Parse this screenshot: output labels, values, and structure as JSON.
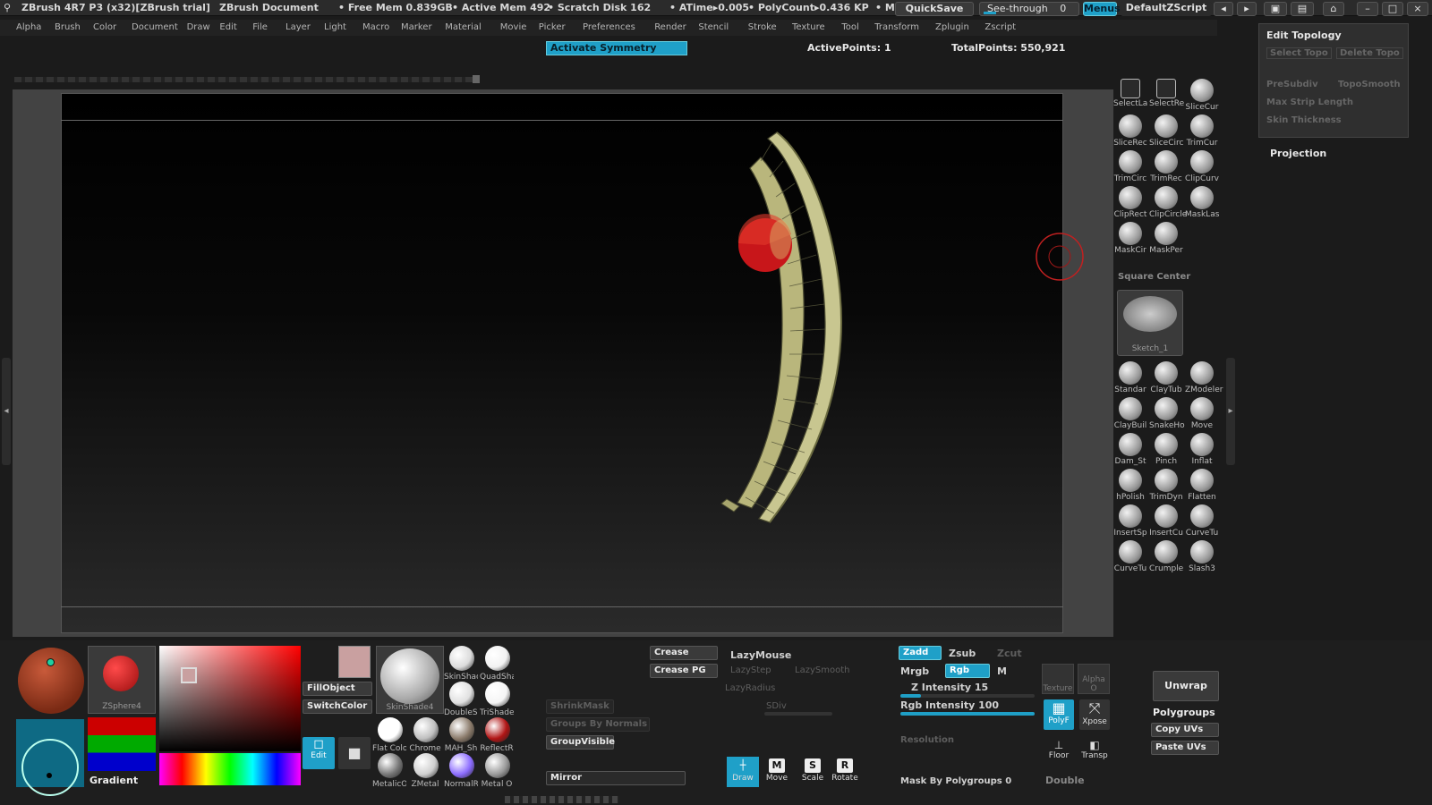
{
  "titlebar": {
    "app_title": "ZBrush 4R7 P3 (x32)[ZBrush trial]",
    "document": "ZBrush Document",
    "free_mem": "• Free Mem 0.839GB",
    "active_mem": "• Active Mem 492",
    "scratch_disk": "• Scratch Disk 162",
    "atime": "• ATime▸0.005",
    "polycount": "• PolyCount▸0.436 KP",
    "bullet": "• M",
    "quicksave": "QuickSave",
    "see_through_label": "See-through",
    "see_through_value": "0",
    "see_through_level": 0,
    "menus": "Menus",
    "script": "DefaultZScript"
  },
  "menubar": {
    "items": [
      "Alpha",
      "Brush",
      "Color",
      "Document",
      "Draw",
      "Edit",
      "File",
      "Layer",
      "Light",
      "Macro",
      "Marker",
      "Material",
      "Movie",
      "Picker",
      "Preferences",
      "Render",
      "Stencil",
      "Stroke",
      "Texture",
      "Tool",
      "Transform",
      "Zplugin",
      "Zscript"
    ]
  },
  "status": {
    "symmetry": "Activate Symmetry",
    "active_points": "ActivePoints: 1",
    "total_points": "TotalPoints: 550,921"
  },
  "topology": {
    "title": "Edit Topology",
    "select_topo": "Select Topo",
    "delete_topo": "Delete Topo",
    "presubdiv": "PreSubdiv",
    "toposmooth": "TopoSmooth",
    "max_strip": "Max Strip Length",
    "skin_thickness": "Skin Thickness",
    "projection": "Projection"
  },
  "palette": {
    "square_center": "Square Center",
    "sketch": "Sketch_1",
    "tools": [
      {
        "label": "SelectLa",
        "icon": "select-lasso-icon"
      },
      {
        "label": "SelectRe",
        "icon": "select-rect-icon"
      },
      {
        "label": "SliceCur",
        "icon": "slice-curve-icon"
      },
      {
        "label": "SliceRec",
        "icon": "slice-rect-icon"
      },
      {
        "label": "SliceCirc",
        "icon": "slice-circle-icon"
      },
      {
        "label": "TrimCur",
        "icon": "trim-curve-icon"
      },
      {
        "label": "TrimCirc",
        "icon": "trim-circle-icon"
      },
      {
        "label": "TrimRec",
        "icon": "trim-rect-icon"
      },
      {
        "label": "ClipCurv",
        "icon": "clip-curve-icon"
      },
      {
        "label": "ClipRect",
        "icon": "clip-rect-icon"
      },
      {
        "label": "ClipCircle",
        "icon": "clip-circle-icon"
      },
      {
        "label": "MaskLas",
        "icon": "mask-lasso-icon"
      },
      {
        "label": "MaskCir",
        "icon": "mask-circle-icon"
      },
      {
        "label": "MaskPer",
        "icon": "mask-pen-icon"
      }
    ],
    "brushes": [
      {
        "label": "Standar",
        "icon": "standard-brush-icon"
      },
      {
        "label": "ClayTub",
        "icon": "claytubes-brush-icon"
      },
      {
        "label": "ZModeler",
        "icon": "zmodeler-brush-icon"
      },
      {
        "label": "ClayBuil",
        "icon": "claybuildup-brush-icon"
      },
      {
        "label": "SnakeHo",
        "icon": "snakehook-brush-icon"
      },
      {
        "label": "Move",
        "icon": "move-brush-icon"
      },
      {
        "label": "Dam_St",
        "icon": "damstandard-brush-icon"
      },
      {
        "label": "Pinch",
        "icon": "pinch-brush-icon"
      },
      {
        "label": "Inflat",
        "icon": "inflate-brush-icon"
      },
      {
        "label": "hPolish",
        "icon": "hpolish-brush-icon"
      },
      {
        "label": "TrimDyn",
        "icon": "trimdynamic-brush-icon"
      },
      {
        "label": "Flatten",
        "icon": "flatten-brush-icon"
      },
      {
        "label": "InsertSp",
        "icon": "insertsphere-brush-icon"
      },
      {
        "label": "InsertCu",
        "icon": "insertcube-brush-icon"
      },
      {
        "label": "CurveTu",
        "icon": "curvetube-brush-icon"
      },
      {
        "label": "CurveTu",
        "icon": "curvetube-brush-icon"
      },
      {
        "label": "Crumple",
        "icon": "crumple-brush-icon"
      },
      {
        "label": "Slash3",
        "icon": "slash3-brush-icon"
      }
    ]
  },
  "tray": {
    "zsphere": "ZSphere4",
    "gradient": "Gradient",
    "fill_object": "FillObject",
    "switch_color": "SwitchColor",
    "edit": "Edit",
    "skinshade": "SkinShade4",
    "materials": [
      {
        "label": "SkinShac",
        "color": "#dcdcdc"
      },
      {
        "label": "QuadSha",
        "color": "#f2f2f2"
      },
      {
        "label": "DoubleSh",
        "color": "#e0e0e0"
      },
      {
        "label": "TriShade",
        "color": "#f5f5f5"
      },
      {
        "label": "Flat Colo",
        "color": "#ffffff"
      },
      {
        "label": "Chrome",
        "color": "#bfbfbf"
      },
      {
        "label": "MAH_Sh",
        "color": "#8a7a6a"
      },
      {
        "label": "ReflectR",
        "color": "#b01515"
      },
      {
        "label": "MetalicO",
        "color": "#777777"
      },
      {
        "label": "ZMetal",
        "color": "#cfcfcf"
      },
      {
        "label": "NormalR",
        "color": "#8c6cff"
      },
      {
        "label": "Metal O",
        "color": "#9a9a9a"
      }
    ],
    "shrink_mask": "ShrinkMask",
    "groups_by_normals": "Groups By Normals",
    "group_visible": "GroupVisible",
    "mirror": "Mirror",
    "crease": "Crease",
    "crease_pg": "Crease PG",
    "lazymouse": "LazyMouse",
    "lazystep": "LazyStep",
    "lazysmooth": "LazySmooth",
    "lazyradius": "LazyRadius",
    "sdiv": "SDiv",
    "draw": "Draw",
    "move": "Move",
    "scale": "Scale",
    "rotate": "Rotate",
    "zadd": "Zadd",
    "zsub": "Zsub",
    "zcut": "Zcut",
    "mrgb": "Mrgb",
    "rgb": "Rgb",
    "m": "M",
    "z_intensity": "Z Intensity 15",
    "z_intensity_level": 0.15,
    "rgb_intensity": "Rgb Intensity 100",
    "rgb_intensity_level": 1.0,
    "resolution": "Resolution",
    "mask_by_polygroups": "Mask By Polygroups 0",
    "double": "Double",
    "texture": "Texture",
    "alpha": "Alpha O",
    "polyf": "PolyF",
    "xpose": "Xpose",
    "floor": "Floor",
    "transp": "Transp",
    "unwrap": "Unwrap",
    "polygroups": "Polygroups",
    "copy_uvs": "Copy UVs",
    "paste_uvs": "Paste UVs"
  },
  "colors": {
    "accent": "#1fa0c8",
    "brush_red": "#c8161a",
    "topology_mesh": "#c8c690"
  }
}
